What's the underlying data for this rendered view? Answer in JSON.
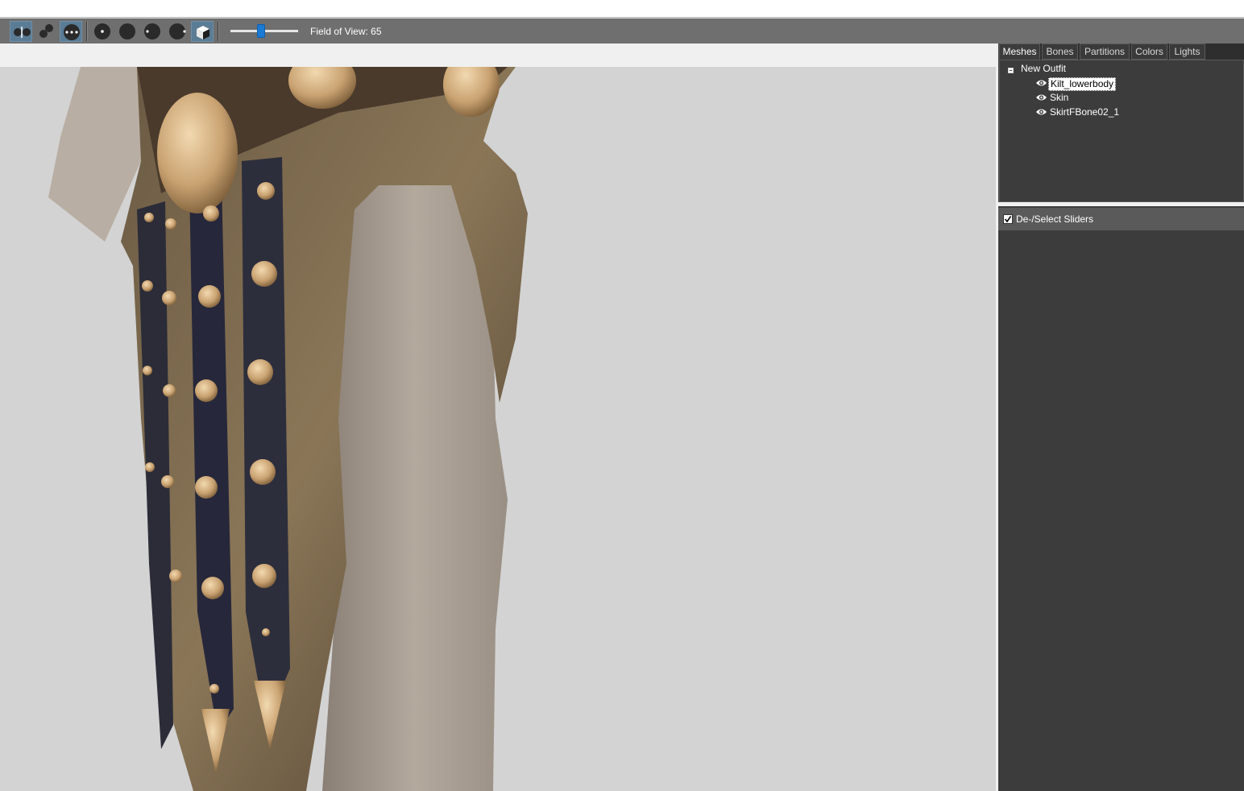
{
  "toolbar": {
    "buttons": [
      {
        "name": "brush-mask-icon",
        "active": true
      },
      {
        "name": "brush-inflate-icon",
        "active": false
      },
      {
        "name": "brush-smooth-icon",
        "active": true
      },
      {
        "name": "brush-deflate-icon",
        "active": false
      },
      {
        "name": "brush-move-icon",
        "active": false
      },
      {
        "name": "brush-weight-icon",
        "active": false
      },
      {
        "name": "brush-color-icon",
        "active": false
      },
      {
        "name": "cube-view-icon",
        "active": true
      }
    ],
    "fov_label": "Field of View: 65",
    "fov_slider_fraction": 0.45
  },
  "panel": {
    "tabs": [
      "Meshes",
      "Bones",
      "Partitions",
      "Colors",
      "Lights"
    ],
    "active_tab": "Meshes",
    "tree": {
      "root": "New Outfit",
      "items": [
        {
          "label": "Kilt_lowerbody",
          "selected": true
        },
        {
          "label": "Skin",
          "selected": false
        },
        {
          "label": "SkirtFBone02_1",
          "selected": false
        }
      ]
    },
    "sliders_header": {
      "label": "De-/Select Sliders",
      "checked": true
    }
  },
  "colors": {
    "toolbar_bg": "#6f6f6f",
    "panel_bg": "#3c3c3c",
    "viewport_bg": "#d3d3d3",
    "accent": "#1a7ad4"
  }
}
